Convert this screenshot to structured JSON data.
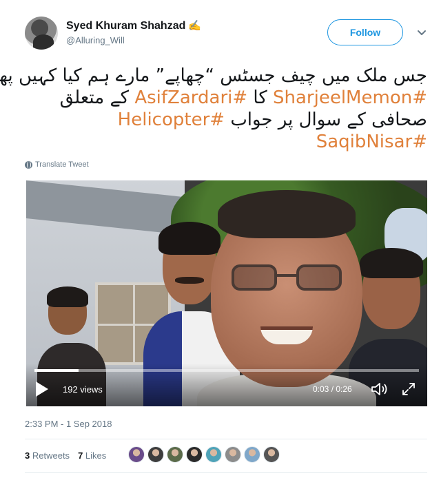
{
  "user": {
    "display_name": "Syed Khuram Shahzad",
    "name_emoji": "✍",
    "handle": "@Alluring_Will"
  },
  "follow_button": {
    "label": "Follow"
  },
  "tweet": {
    "line1_text": "جس ملک میں چیف جسٹس “چھاپے” مارے ہم کیا کہیں پھر؟",
    "line2_tag1": "#SharjeelMemon",
    "line2_mid": " کا ",
    "line2_tag2": "#AsifZardari",
    "line2_end": " کے متعلق",
    "line3_start": "صحافی کے سوال پر جواب ",
    "line3_tag": "#Helicopter",
    "line4_tag": "#SaqibNisar"
  },
  "translate_label": "Translate Tweet",
  "video": {
    "views": "192 views",
    "current_time": "0:03",
    "duration": "0:26",
    "time_display": "0:03 / 0:26",
    "progress_fraction": 0.115
  },
  "timestamp": "2:33 PM - 1 Sep 2018",
  "stats": {
    "retweets_count": "3",
    "retweets_label": "Retweets",
    "likes_count": "7",
    "likes_label": "Likes"
  },
  "likers": [
    {
      "name": "liker-avatar-1",
      "color": "#6a4c8a"
    },
    {
      "name": "liker-avatar-2",
      "color": "#3d3d3d"
    },
    {
      "name": "liker-avatar-3",
      "color": "#5b6b4a"
    },
    {
      "name": "liker-avatar-4",
      "color": "#2a2a2a"
    },
    {
      "name": "liker-avatar-5",
      "color": "#4fa3b8"
    },
    {
      "name": "liker-avatar-6",
      "color": "#8c8c8c"
    },
    {
      "name": "liker-avatar-7",
      "color": "#7fa7c9"
    },
    {
      "name": "liker-avatar-8",
      "color": "#555555"
    }
  ],
  "colors": {
    "hashtag": "#e0813b",
    "follow": "#1b95e0",
    "muted": "#657786"
  }
}
